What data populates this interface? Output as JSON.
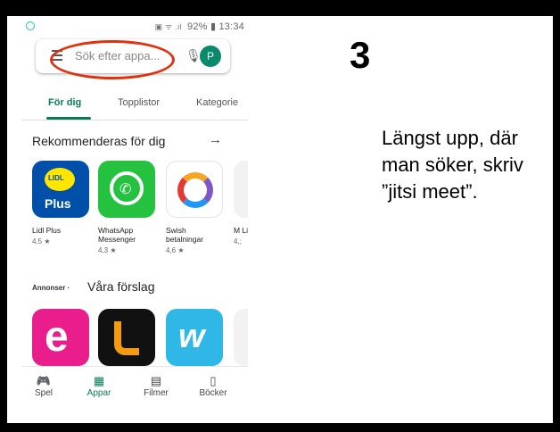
{
  "status_bar": {
    "icons": "▣ ᯤ .ıl",
    "battery": "92%",
    "time": "13:34"
  },
  "search": {
    "placeholder": "Sök efter appa...",
    "avatar_letter": "P"
  },
  "tabs": [
    {
      "label": "För dig"
    },
    {
      "label": "Topplistor"
    },
    {
      "label": "Kategorie"
    }
  ],
  "recommended": {
    "title": "Rekommenderas för dig",
    "arrow": "→",
    "apps": [
      {
        "name": "Lidl Plus",
        "rating": "4,5 ★",
        "logo_text": "LIDL",
        "plus": "Plus"
      },
      {
        "name": "WhatsApp Messenger",
        "rating": "4,3 ★"
      },
      {
        "name": "Swish betalningar",
        "rating": "4,6 ★"
      },
      {
        "name": "M Lit",
        "rating": "4,;"
      }
    ]
  },
  "suggestions": {
    "ads_label": "Annonser ·",
    "title": "Våra förslag",
    "e_letter": "e",
    "w_letter": "w"
  },
  "bottom_nav": [
    {
      "label": "Spel",
      "icon": "gamepad-icon"
    },
    {
      "label": "Appar",
      "icon": "apps-icon"
    },
    {
      "label": "Filmer",
      "icon": "film-icon"
    },
    {
      "label": "Böcker",
      "icon": "book-icon"
    }
  ],
  "instruction": {
    "step": "3",
    "text": "Längst upp, där man söker, skriv ”jitsi meet”."
  },
  "colors": {
    "accent": "#0a7a5a",
    "highlight": "#d31"
  }
}
